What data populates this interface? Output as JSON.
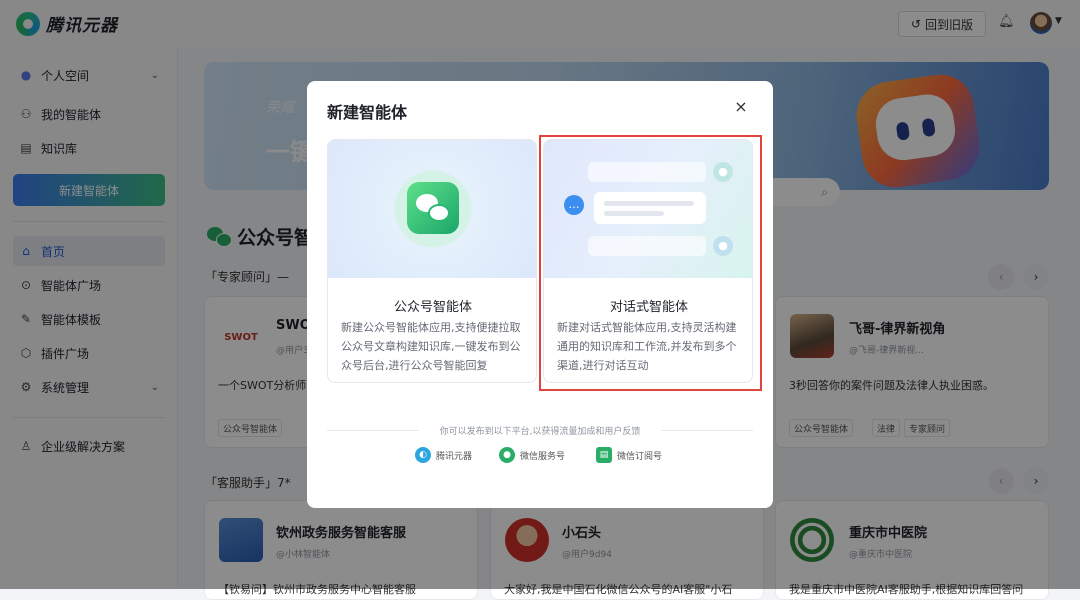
{
  "app": {
    "logo_text": "腾讯元器",
    "back_button": "回到旧版",
    "back_icon": "↺",
    "bell_icon": "bell-icon"
  },
  "sidebar": {
    "space": "个人空间",
    "items": [
      {
        "label": "我的智能体",
        "icon": "⚇"
      },
      {
        "label": "知识库",
        "icon": "▤"
      }
    ],
    "new_agent": "新建智能体",
    "nav": [
      {
        "label": "首页",
        "icon": "⌂",
        "active": true
      },
      {
        "label": "智能体广场",
        "icon": "⊙"
      },
      {
        "label": "智能体模板",
        "icon": "✎"
      },
      {
        "label": "插件广场",
        "icon": "⬡"
      },
      {
        "label": "系统管理",
        "icon": "⚙"
      }
    ],
    "enterprise": "企业级解决方案"
  },
  "banner": {
    "title": "荣耀",
    "subtitle": "一键"
  },
  "section": {
    "title": "公众号智",
    "sub1": "「专家顾问」—",
    "sub2": "「客服助手」7*"
  },
  "cards_row1": [
    {
      "name": "SWOT",
      "handle": "@用户3",
      "desc": "一个SWOT分析师",
      "logo": "SWOT",
      "tags": [
        "公众号智能体"
      ]
    },
    {
      "name": "飞哥-律界新视角",
      "handle": "@飞哥-律界新视...",
      "desc": "3秒回答你的案件问题及法律人执业困惑。",
      "tags": [
        "公众号智能体",
        "法律",
        "专家顾问"
      ]
    }
  ],
  "cards_row2": [
    {
      "name": "钦州政务服务智能客服",
      "handle": "@小林智能体",
      "desc": "【钦易问】钦州市政务服务中心智能客服"
    },
    {
      "name": "小石头",
      "handle": "@用户9d94",
      "desc": "大家好,我是中国石化微信公众号的AI客服\"小石"
    },
    {
      "name": "重庆市中医院",
      "handle": "@重庆市中医院",
      "desc": "我是重庆市中医院AI客服助手,根据知识库回答问"
    }
  ],
  "modal": {
    "title": "新建智能体",
    "close_icon": "×",
    "options": [
      {
        "title": "公众号智能体",
        "desc": "新建公众号智能体应用,支持便捷拉取公众号文章构建知识库,一键发布到公众号后台,进行公众号智能回复"
      },
      {
        "title": "对话式智能体",
        "desc": "新建对话式智能体应用,支持灵活构建通用的知识库和工作流,并发布到多个渠道,进行对话互动"
      }
    ],
    "footer": "你可以发布到以下平台,以获得流量加成和用户反馈",
    "platforms": [
      {
        "label": "腾讯元器",
        "color": "#2aa6e0"
      },
      {
        "label": "微信服务号",
        "color": "#2aae67"
      },
      {
        "label": "微信订阅号",
        "color": "#2aae67"
      }
    ]
  },
  "colors": {
    "accent": "#1f5bd8",
    "highlight": "#e0443c",
    "wechat_green": "#2aae67"
  }
}
